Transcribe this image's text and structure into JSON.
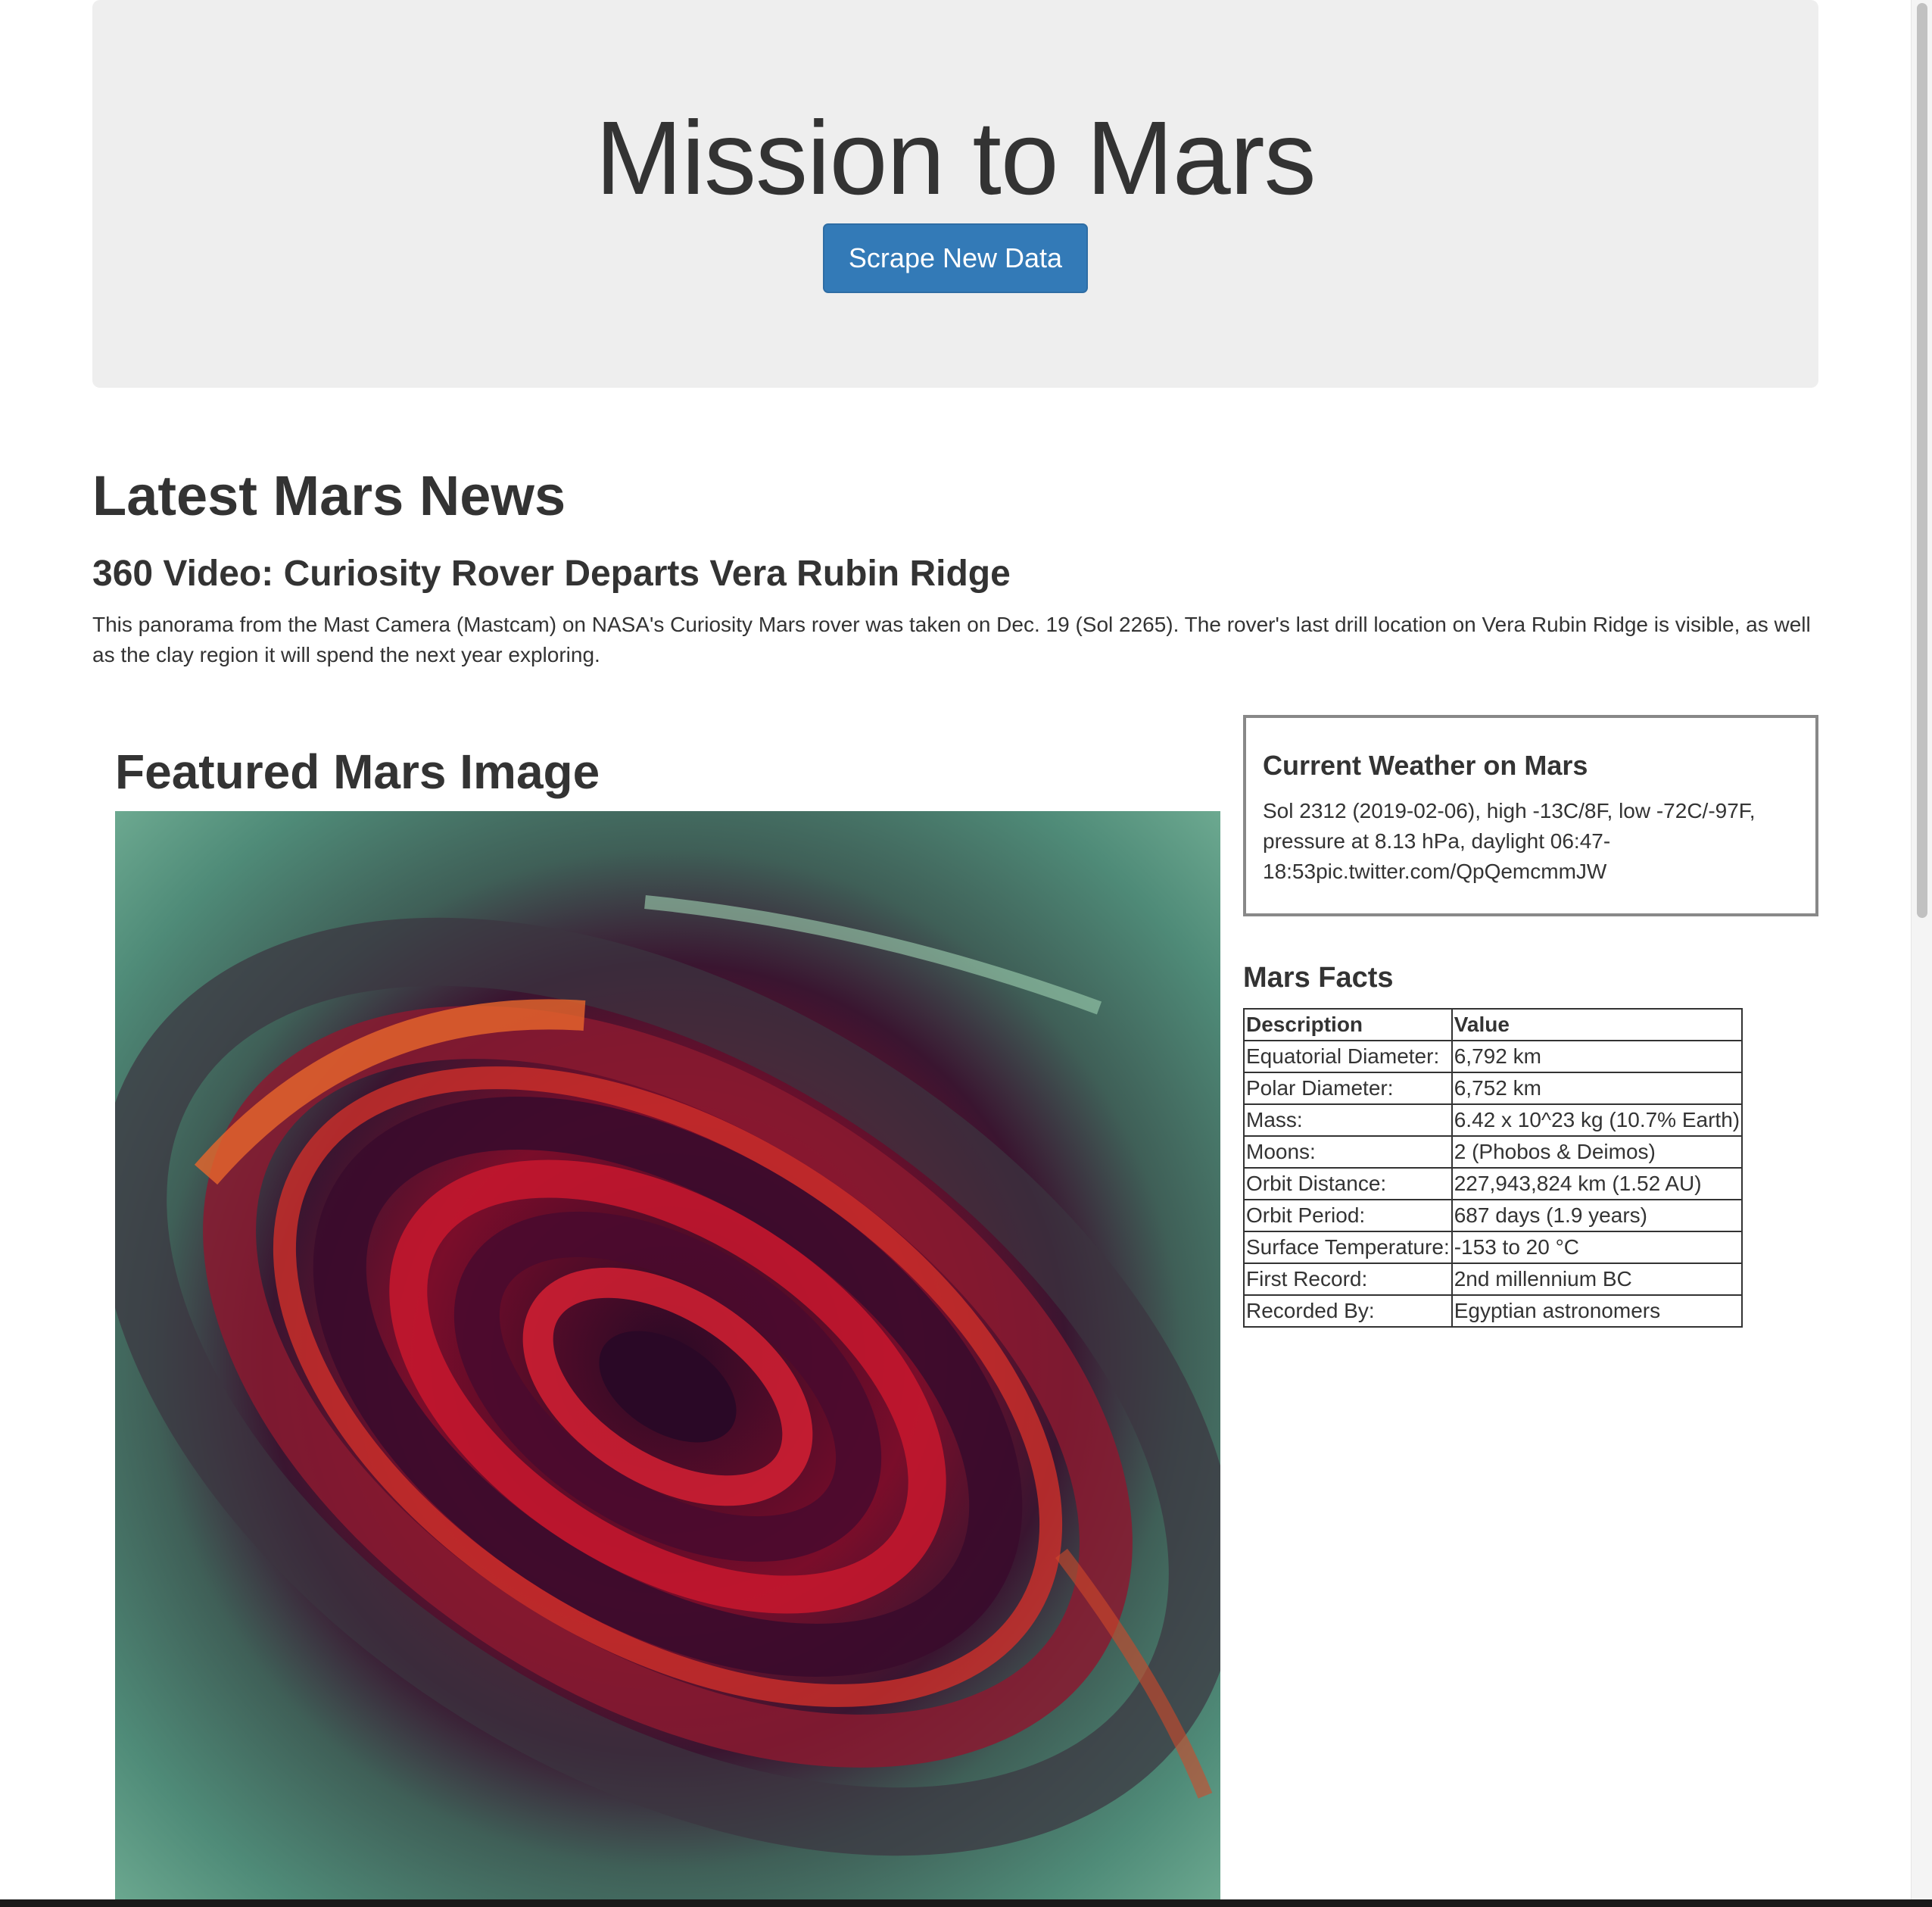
{
  "jumbotron": {
    "title": "Mission to Mars",
    "button_label": "Scrape New Data"
  },
  "news": {
    "heading": "Latest Mars News",
    "title": "360 Video: Curiosity Rover Departs Vera Rubin Ridge",
    "paragraph": "This panorama from the Mast Camera (Mastcam) on NASA's Curiosity Mars rover was taken on Dec. 19 (Sol 2265). The rover's last drill location on Vera Rubin Ridge is visible, as well as the clay region it will spend the next year exploring."
  },
  "featured": {
    "heading": "Featured Mars Image"
  },
  "weather": {
    "heading": "Current Weather on Mars",
    "text": "Sol 2312 (2019-02-06), high -13C/8F, low -72C/-97F, pressure at 8.13 hPa, daylight 06:47-18:53pic.twitter.com/QpQemcmmJW"
  },
  "facts": {
    "heading": "Mars Facts",
    "columns": [
      "Description",
      "Value"
    ],
    "rows": [
      [
        "Equatorial Diameter:",
        "6,792 km"
      ],
      [
        "Polar Diameter:",
        "6,752 km"
      ],
      [
        "Mass:",
        "6.42 x 10^23 kg (10.7% Earth)"
      ],
      [
        "Moons:",
        "2 (Phobos & Deimos)"
      ],
      [
        "Orbit Distance:",
        "227,943,824 km (1.52 AU)"
      ],
      [
        "Orbit Period:",
        "687 days (1.9 years)"
      ],
      [
        "Surface Temperature:",
        "-153 to 20 °C"
      ],
      [
        "First Record:",
        "2nd millennium BC"
      ],
      [
        "Recorded By:",
        "Egyptian astronomers"
      ]
    ]
  },
  "colors": {
    "button_bg": "#337ab7",
    "jumbotron_bg": "#eeeeee",
    "text": "#333333"
  }
}
